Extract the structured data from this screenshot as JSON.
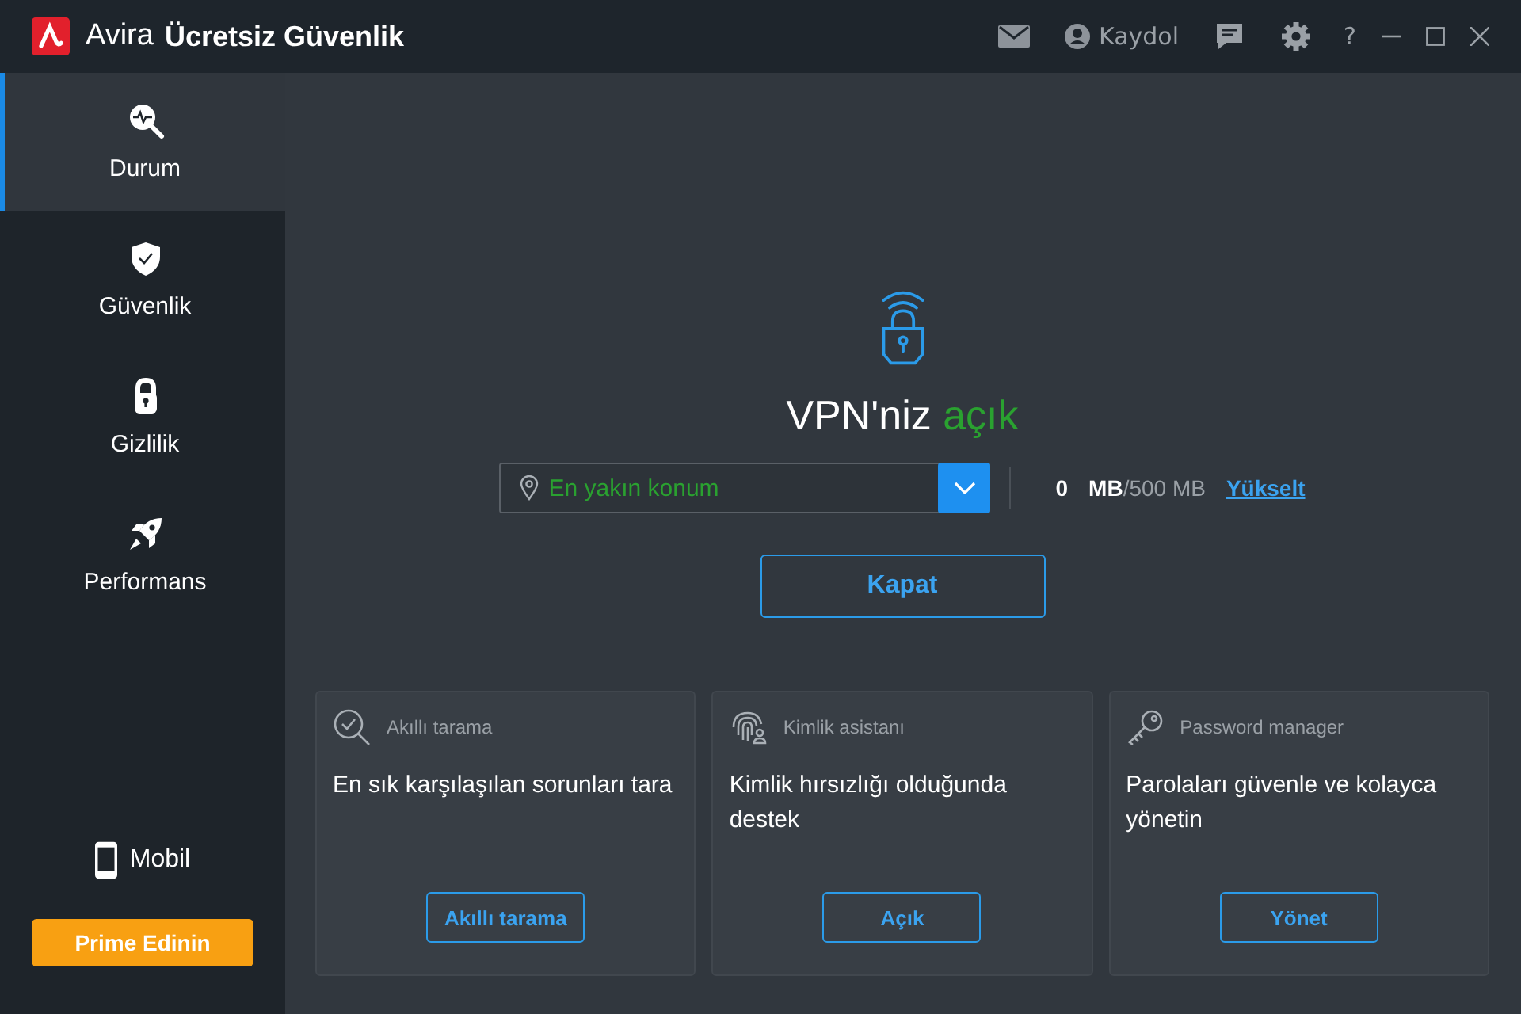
{
  "window": {
    "brand": "Avira",
    "title": "Ücretsiz Güvenlik",
    "account": "Kaydol",
    "help": "?"
  },
  "sidebar": {
    "items": [
      {
        "label": "Durum",
        "selected": true
      },
      {
        "label": "Güvenlik",
        "selected": false
      },
      {
        "label": "Gizlilik",
        "selected": false
      },
      {
        "label": "Performans",
        "selected": false
      }
    ],
    "mobile": "Mobil",
    "upgrade_button": "Prime Edinin"
  },
  "vpn": {
    "heading": "VPN'niz",
    "status": "açık",
    "on": true,
    "location": {
      "value": "En yakın konum"
    },
    "usage": {
      "used": "0",
      "unit": "MB",
      "limit": "/500 MB"
    },
    "upgrade_link": "Yükselt",
    "button": "Kapat"
  },
  "cards": [
    {
      "title": "Akıllı tarama",
      "text": "En sık karşılaşılan sorunları tara",
      "button": "Akıllı tarama"
    },
    {
      "title": "Kimlik asistanı",
      "text": "Kimlik hırsızlığı olduğunda destek",
      "button": "Açık"
    },
    {
      "title": "Password manager",
      "text": "Parolaları güvenle ve kolayca yönetin",
      "button": "Yönet"
    }
  ]
}
